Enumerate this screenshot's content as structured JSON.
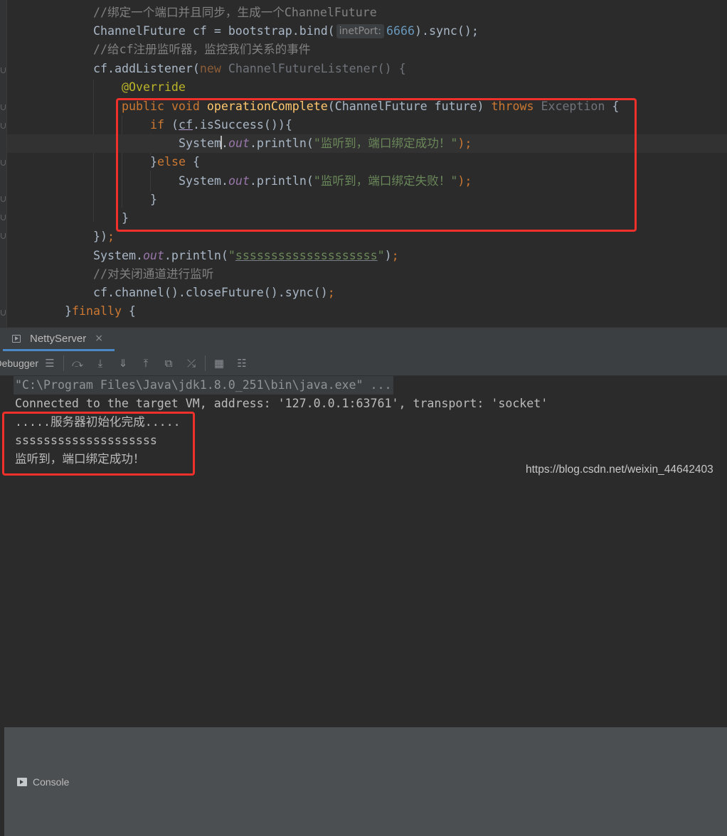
{
  "editor": {
    "lines": {
      "l1_comment": "//绑定一个端口并且同步，生成一个ChannelFuture",
      "l2_a": "ChannelFuture cf = bootstrap.bind(",
      "l2_hint": "inetPort:",
      "l2_num": "6666",
      "l2_b": ").sync();",
      "l3_comment": "//给cf注册监听器，监控我们关系的事件",
      "l4_a": "cf.addListener(",
      "l4_new": "new",
      "l4_cls": " ChannelFutureListener() {",
      "l5_ann": "@Override",
      "l6_public": "public",
      "l6_void": " void ",
      "l6_fn": "operationComplete",
      "l6_params": "(ChannelFuture future) ",
      "l6_throws": "throws",
      "l6_exc": " Exception",
      "l6_brace": " {",
      "l7_if": "if",
      "l7_open": " (",
      "l7_cf": "cf",
      "l7_rest": ".isSuccess()){",
      "l8_sys": "System",
      "l8_dot": ".",
      "l8_out": "out",
      "l8_println": ".println(",
      "l8_str": "\"监听到，端口绑定成功！\"",
      "l8_end": ");",
      "l9_close": "}",
      "l9_else": "else",
      "l9_brace": " {",
      "l10_sys": "System.",
      "l10_out": "out",
      "l10_println": ".println(",
      "l10_str": "\"监听到，端口绑定失败！\"",
      "l10_end": ");",
      "l11": "}",
      "l12": "}",
      "l13_a": "})",
      "l13_semi": ";",
      "l14_sys": "System.",
      "l14_out": "out",
      "l14_println": ".println(",
      "l14_q1": "\"",
      "l14_str": "ssssssssssssssssssss",
      "l14_q2": "\"",
      "l14_end": ")",
      "l14_semi": ";",
      "l15_comment": "//对关闭通道进行监听",
      "l16": "cf.channel().closeFuture().sync()",
      "l16_semi": ";",
      "l17_close": "}",
      "l17_finally": "finally",
      "l17_brace": " {"
    }
  },
  "run_panel": {
    "tab_label": "NettyServer",
    "close_glyph": "×",
    "debugger_label": "Debugger",
    "console_label": "Console",
    "toolbar_icons": [
      "list-icon",
      "step-over-icon",
      "step-into-icon",
      "force-step-into-icon",
      "step-out-icon",
      "drop-frame-icon",
      "run-to-cursor-icon",
      "evaluate-icon",
      "trace-icon"
    ]
  },
  "console": {
    "line1": "\"C:\\Program Files\\Java\\jdk1.8.0_251\\bin\\java.exe\" ...",
    "line2": "Connected to the target VM, address: '127.0.0.1:63761', transport: 'socket'",
    "line3": ".....服务器初始化完成.....",
    "line4": "ssssssssssssssssssss",
    "line5": "监听到，端口绑定成功！"
  },
  "watermark": "https://blog.csdn.net/weixin_44642403",
  "colors": {
    "background": "#2b2b2b",
    "keyword": "#cc7832",
    "method": "#ffc66d",
    "string": "#6a8759",
    "comment": "#808080",
    "static_field": "#9876aa",
    "annotation": "#bbb529",
    "number": "#6897bb",
    "highlight_box": "#f0302a",
    "tab_underline": "#4a88c7"
  }
}
